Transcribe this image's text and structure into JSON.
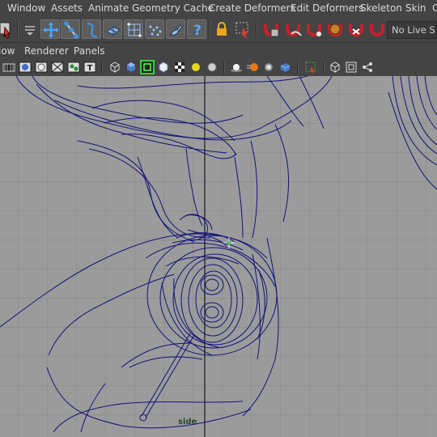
{
  "menubar": {
    "items": [
      "Window",
      "Assets",
      "Animate",
      "Geometry Cache",
      "Create Deformers",
      "Edit Deformers",
      "Skeleton",
      "Skin",
      "C"
    ]
  },
  "status_line": {
    "live_field": "No Live S"
  },
  "shelf": {
    "icons": [
      "select-tool-icon",
      "move-tool-icon",
      "joint-tool-icon",
      "ik-spline-icon",
      "lattice-icon",
      "cluster-icon",
      "soft-mod-icon",
      "paint-weights-icon",
      "help-icon",
      "lock-icon",
      "select-vertices-icon",
      "magnet-1-icon",
      "magnet-2-icon",
      "magnet-3-icon",
      "magnet-4-icon",
      "magnet-5-icon",
      "magnet-6-icon"
    ]
  },
  "panel": {
    "menu": [
      "iow",
      "Renderer",
      "Panels"
    ],
    "camera_label": "side"
  },
  "colors": {
    "ui_bg": "#444444",
    "viewport_bg": "#9a9a9a",
    "wire": "#12127a",
    "grid": "#888888",
    "magnet_red": "#c8202a"
  }
}
